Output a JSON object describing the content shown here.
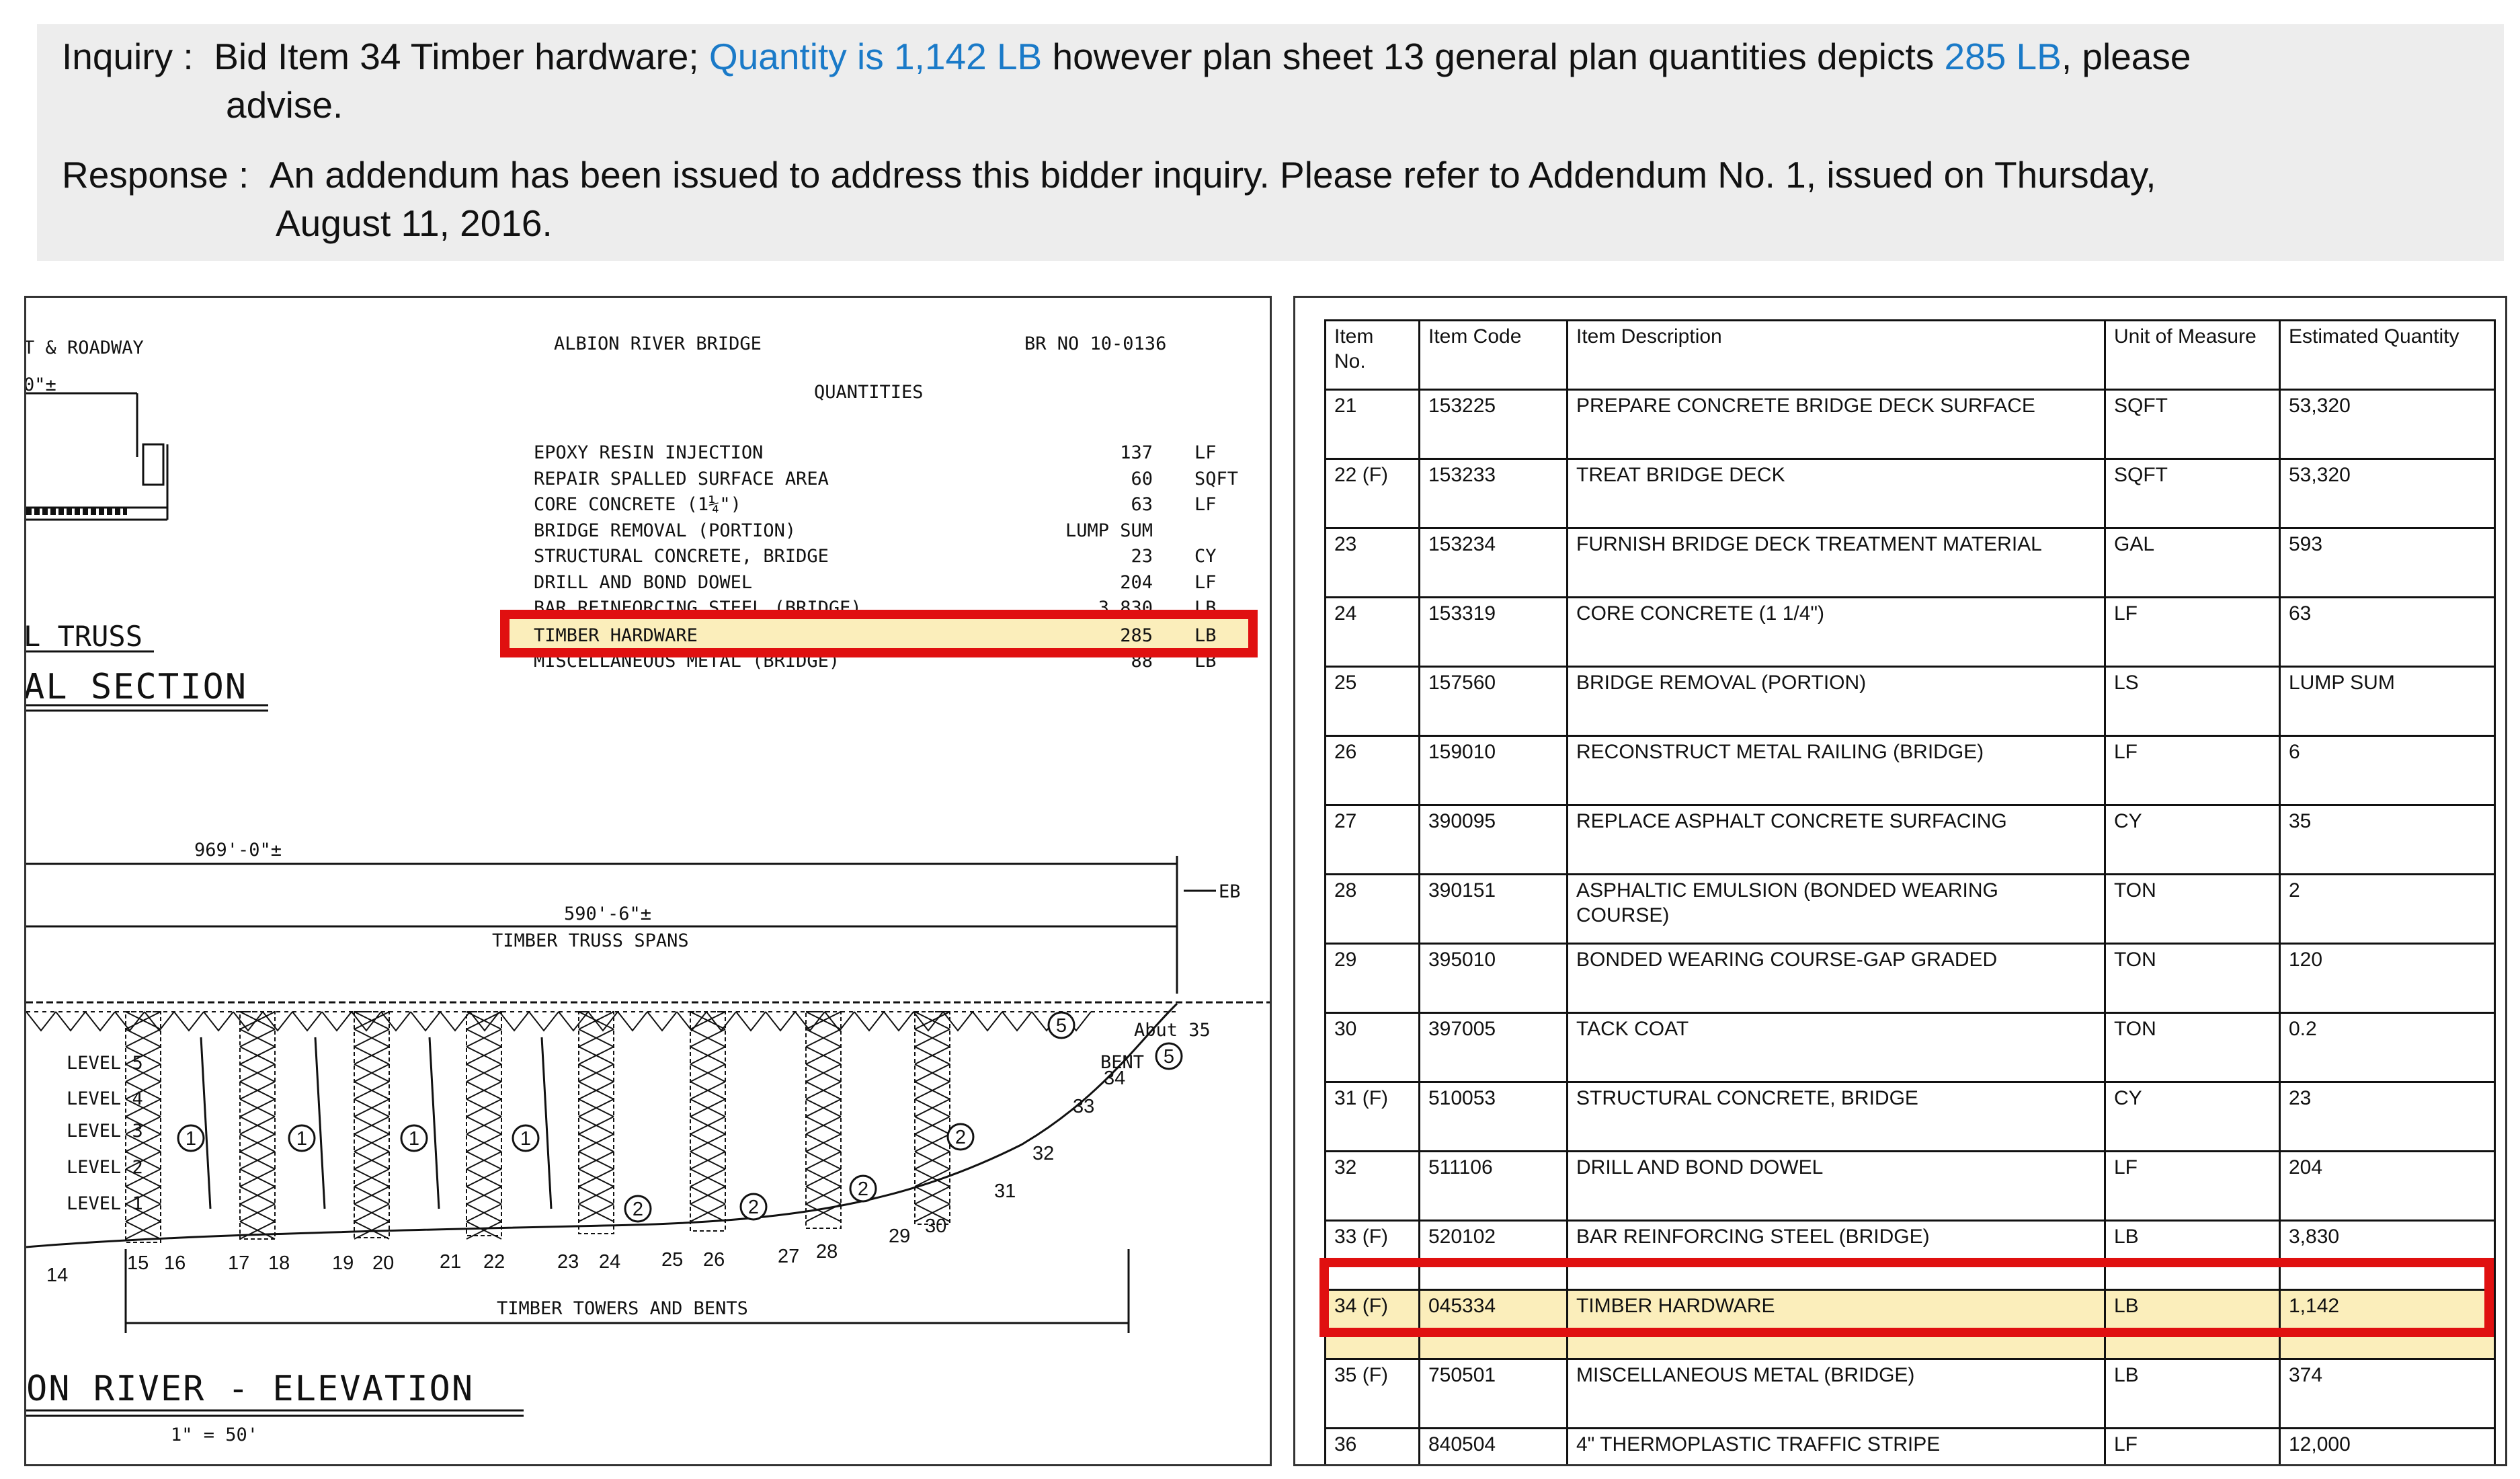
{
  "inquiry": {
    "label": "Inquiry :",
    "text_a": "Bid Item 34 Timber hardware;",
    "highlight_a": "Quantity is 1,142 LB",
    "text_b": "however plan sheet 13 general plan quantities depicts",
    "highlight_b": "285 LB",
    "text_c": ", please",
    "line2": "advise."
  },
  "response": {
    "label": "Response :",
    "line1": "An addendum has been issued to address this bidder inquiry.  Please refer to Addendum  No. 1, issued on Thursday,",
    "line2": "August 11, 2016."
  },
  "drawing": {
    "header_left": "T & ROADWAY",
    "header_left_dim": "0\"±",
    "title": "ALBION RIVER BRIDGE",
    "br_no": "BR NO 10-0136",
    "quantities_heading": "QUANTITIES",
    "quantities": [
      {
        "item": "EPOXY RESIN INJECTION",
        "qty": "137",
        "unit": "LF"
      },
      {
        "item": "REPAIR SPALLED SURFACE AREA",
        "qty": "60",
        "unit": "SQFT"
      },
      {
        "item": "CORE CONCRETE (1¼\")",
        "qty": "63",
        "unit": "LF"
      },
      {
        "item": "BRIDGE REMOVAL (PORTION)",
        "qty": "LUMP SUM",
        "unit": ""
      },
      {
        "item": "STRUCTURAL CONCRETE, BRIDGE",
        "qty": "23",
        "unit": "CY"
      },
      {
        "item": "DRILL AND BOND DOWEL",
        "qty": "204",
        "unit": "LF"
      },
      {
        "item": "BAR REINFORCING STEEL (BRIDGE)",
        "qty": "3,830",
        "unit": "LB"
      },
      {
        "item": "TIMBER HARDWARE",
        "qty": "285",
        "unit": "LB"
      },
      {
        "item": "MISCELLANEOUS METAL (BRIDGE)",
        "qty": "88",
        "unit": "LB"
      }
    ],
    "truss_label": "L TRUSS",
    "section_label": "AL SECTION",
    "dim_total": "969'-0\"±",
    "dim_spans": "590'-6\"±",
    "spans_label": "TIMBER TRUSS SPANS",
    "eb_label": "EB",
    "abut_label": "Abut 35",
    "bent_label": "BENT",
    "bent_circle": "5",
    "levels": [
      "LEVEL 5",
      "LEVEL 4",
      "LEVEL 3",
      "LEVEL 2",
      "LEVEL 1"
    ],
    "circle_1": "1",
    "circle_2": "2",
    "circle_5": "5",
    "bent_numbers": [
      "14",
      "15",
      "16",
      "17",
      "18",
      "19",
      "20",
      "21",
      "22",
      "23",
      "24",
      "25",
      "26",
      "27",
      "28",
      "29",
      "30",
      "31",
      "32",
      "33",
      "34"
    ],
    "towers_label": "TIMBER TOWERS AND BENTS",
    "elevation_label": "ON RIVER - ELEVATION",
    "scale_label": "1\" = 50'"
  },
  "table": {
    "headers": [
      "Item No.",
      "Item Code",
      "Item Description",
      "Unit of Measure",
      "Estimated Quantity"
    ],
    "rows": [
      {
        "no": "21",
        "code": "153225",
        "desc": "PREPARE CONCRETE BRIDGE DECK SURFACE",
        "unit": "SQFT",
        "qty": "53,320"
      },
      {
        "no": "22 (F)",
        "code": "153233",
        "desc": "TREAT BRIDGE DECK",
        "unit": "SQFT",
        "qty": "53,320"
      },
      {
        "no": "23",
        "code": "153234",
        "desc": "FURNISH BRIDGE DECK TREATMENT MATERIAL",
        "unit": "GAL",
        "qty": "593"
      },
      {
        "no": "24",
        "code": "153319",
        "desc": "CORE CONCRETE (1 1/4\")",
        "unit": "LF",
        "qty": "63"
      },
      {
        "no": "25",
        "code": "157560",
        "desc": "BRIDGE REMOVAL (PORTION)",
        "unit": "LS",
        "qty": "LUMP SUM"
      },
      {
        "no": "26",
        "code": "159010",
        "desc": "RECONSTRUCT METAL RAILING (BRIDGE)",
        "unit": "LF",
        "qty": "6"
      },
      {
        "no": "27",
        "code": "390095",
        "desc": "REPLACE ASPHALT CONCRETE SURFACING",
        "unit": "CY",
        "qty": "35"
      },
      {
        "no": "28",
        "code": "390151",
        "desc": "ASPHALTIC EMULSION (BONDED WEARING COURSE)",
        "unit": "TON",
        "qty": "2"
      },
      {
        "no": "29",
        "code": "395010",
        "desc": "BONDED WEARING COURSE-GAP GRADED",
        "unit": "TON",
        "qty": "120"
      },
      {
        "no": "30",
        "code": "397005",
        "desc": "TACK COAT",
        "unit": "TON",
        "qty": "0.2"
      },
      {
        "no": "31 (F)",
        "code": "510053",
        "desc": "STRUCTURAL CONCRETE, BRIDGE",
        "unit": "CY",
        "qty": "23"
      },
      {
        "no": "32",
        "code": "511106",
        "desc": "DRILL AND BOND DOWEL",
        "unit": "LF",
        "qty": "204"
      },
      {
        "no": "33 (F)",
        "code": "520102",
        "desc": "BAR REINFORCING STEEL (BRIDGE)",
        "unit": "LB",
        "qty": "3,830"
      },
      {
        "no": "34 (F)",
        "code": "045334",
        "desc": "TIMBER HARDWARE",
        "unit": "LB",
        "qty": "1,142"
      },
      {
        "no": "35 (F)",
        "code": "750501",
        "desc": "MISCELLANEOUS METAL (BRIDGE)",
        "unit": "LB",
        "qty": "374"
      },
      {
        "no": "36",
        "code": "840504",
        "desc": "4\" THERMOPLASTIC TRAFFIC STRIPE",
        "unit": "LF",
        "qty": "12,000"
      }
    ]
  },
  "colors": {
    "highlight_text": "#1a7ac8",
    "highlight_fill": "#fbeebb",
    "red_box": "#e01010",
    "panel_bg": "#ededed"
  }
}
